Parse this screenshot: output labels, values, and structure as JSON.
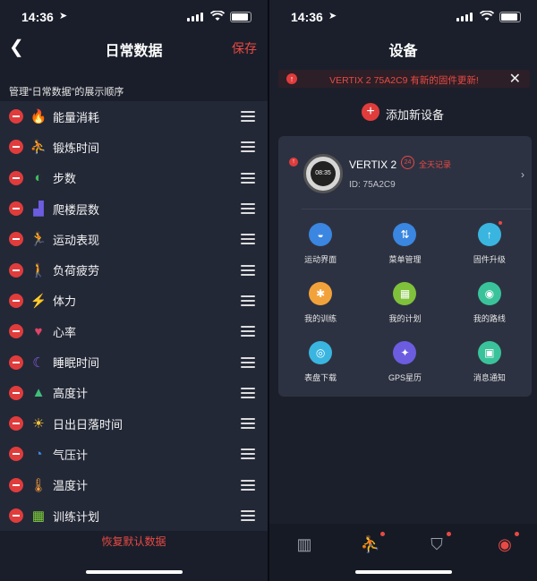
{
  "status_bar": {
    "time": "14:36"
  },
  "left": {
    "title": "日常数据",
    "save_label": "保存",
    "hint": "管理“日常数据”的展示顺序",
    "items": [
      {
        "label": "能量消耗",
        "icon": "flame-icon",
        "color": "#f2a23a"
      },
      {
        "label": "锻炼时间",
        "icon": "run-icon",
        "color": "#e94a8c"
      },
      {
        "label": "步数",
        "icon": "footprint-icon",
        "color": "#3fbf5a"
      },
      {
        "label": "爬楼层数",
        "icon": "stairs-icon",
        "color": "#6b5ce0"
      },
      {
        "label": "运动表现",
        "icon": "runner-icon",
        "color": "#3ab5e0"
      },
      {
        "label": "负荷疲劳",
        "icon": "walker-icon",
        "color": "#3aa0e0"
      },
      {
        "label": "体力",
        "icon": "stamina-icon",
        "color": "#3aa0e0"
      },
      {
        "label": "心率",
        "icon": "heart-icon",
        "color": "#e04466"
      },
      {
        "label": "睡眠时间",
        "icon": "moon-icon",
        "color": "#8b5ce0"
      },
      {
        "label": "高度计",
        "icon": "mountain-icon",
        "color": "#3fbf7a"
      },
      {
        "label": "日出日落时间",
        "icon": "sun-icon",
        "color": "#f2c23a"
      },
      {
        "label": "气压计",
        "icon": "gauge-icon",
        "color": "#3a8be0"
      },
      {
        "label": "温度计",
        "icon": "thermometer-icon",
        "color": "#f29a3a"
      },
      {
        "label": "训练计划",
        "icon": "calendar-icon",
        "color": "#7fd13a"
      }
    ],
    "restore_label": "恢复默认数据"
  },
  "right": {
    "title": "设备",
    "banner": "VERTIX 2 75A2C9 有新的固件更新!",
    "add_device": "添加新设备",
    "device": {
      "model": "VERTIX 2",
      "badge_24": "24",
      "all_day": "全天记录",
      "id": "ID: 75A2C9",
      "watch_time": "08:35"
    },
    "grid": [
      {
        "label": "运动界面",
        "icon": "sport-screen-icon",
        "color": "#3a86e0",
        "glyph": "◒",
        "dot": false
      },
      {
        "label": "菜单管理",
        "icon": "menu-manage-icon",
        "color": "#3a86e0",
        "glyph": "⇅",
        "dot": false
      },
      {
        "label": "固件升级",
        "icon": "firmware-icon",
        "color": "#3ab5e0",
        "glyph": "↑",
        "dot": true
      },
      {
        "label": "我的训练",
        "icon": "training-icon",
        "color": "#f2a23a",
        "glyph": "✱",
        "dot": false
      },
      {
        "label": "我的计划",
        "icon": "plan-icon",
        "color": "#7fc13a",
        "glyph": "▦",
        "dot": false
      },
      {
        "label": "我的路线",
        "icon": "route-icon",
        "color": "#3ac39a",
        "glyph": "◉",
        "dot": false
      },
      {
        "label": "表盘下载",
        "icon": "watchface-icon",
        "color": "#3ab5e0",
        "glyph": "◎",
        "dot": false
      },
      {
        "label": "GPS星历",
        "icon": "gps-icon",
        "color": "#6b5ce0",
        "glyph": "✦",
        "dot": false
      },
      {
        "label": "消息通知",
        "icon": "message-icon",
        "color": "#3ac39a",
        "glyph": "▣",
        "dot": false
      }
    ],
    "tabs": [
      {
        "icon": "stats-icon",
        "glyph": "▥",
        "dot": false
      },
      {
        "icon": "sport-icon",
        "glyph": "⛹",
        "dot": true
      },
      {
        "icon": "shield-icon",
        "glyph": "⛉",
        "dot": true
      },
      {
        "icon": "watch-icon",
        "glyph": "◉",
        "dot": true,
        "active": true
      }
    ]
  }
}
